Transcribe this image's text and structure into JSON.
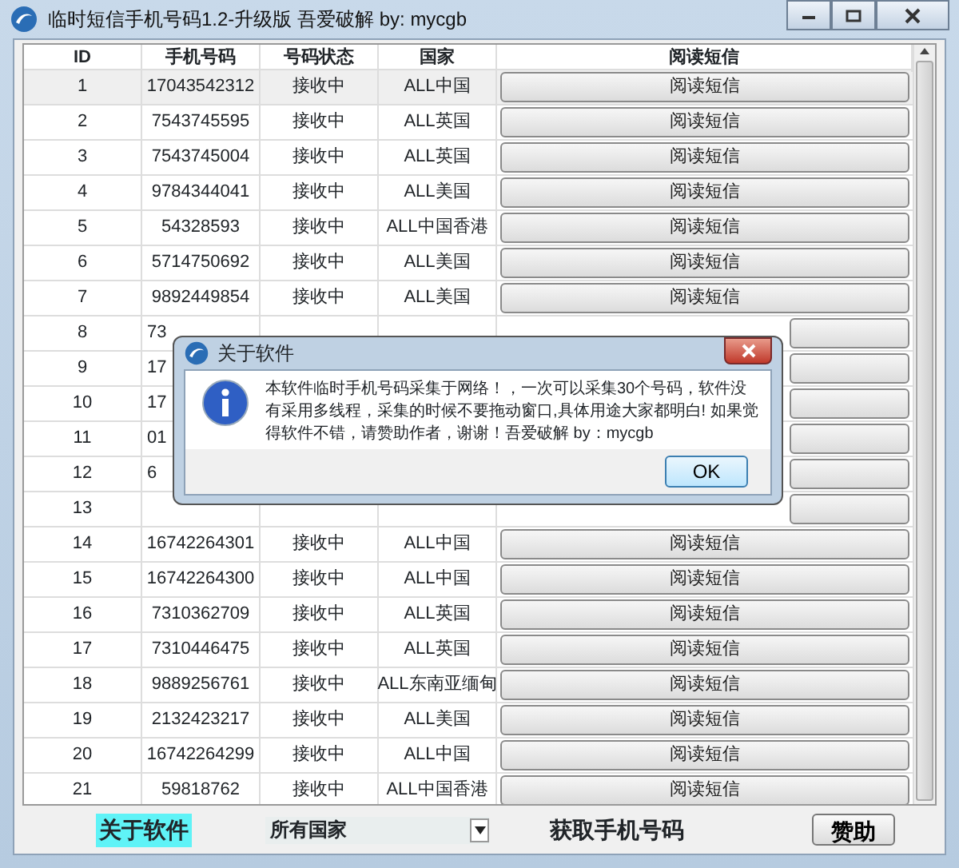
{
  "window": {
    "title": "临时短信手机号码1.2-升级版 吾爱破解 by: mycgb"
  },
  "table": {
    "columns": [
      "ID",
      "手机号码",
      "号码状态",
      "国家",
      "阅读短信"
    ],
    "rows": [
      {
        "kind": "full",
        "id": "1",
        "phone": "17043542312",
        "status": "接收中",
        "country": "ALL中国",
        "action": "阅读短信",
        "selected": true
      },
      {
        "kind": "full",
        "id": "2",
        "phone": "7543745595",
        "status": "接收中",
        "country": "ALL英国",
        "action": "阅读短信",
        "selected": false
      },
      {
        "kind": "full",
        "id": "3",
        "phone": "7543745004",
        "status": "接收中",
        "country": "ALL英国",
        "action": "阅读短信",
        "selected": false
      },
      {
        "kind": "full",
        "id": "4",
        "phone": "9784344041",
        "status": "接收中",
        "country": "ALL美国",
        "action": "阅读短信",
        "selected": false
      },
      {
        "kind": "full",
        "id": "5",
        "phone": "54328593",
        "status": "接收中",
        "country": "ALL中国香港",
        "action": "阅读短信",
        "selected": false
      },
      {
        "kind": "full",
        "id": "6",
        "phone": "5714750692",
        "status": "接收中",
        "country": "ALL美国",
        "action": "阅读短信",
        "selected": false
      },
      {
        "kind": "full",
        "id": "7",
        "phone": "9892449854",
        "status": "接收中",
        "country": "ALL美国",
        "action": "阅读短信",
        "selected": false
      },
      {
        "kind": "covered",
        "id": "8",
        "phone": "73",
        "selected": false
      },
      {
        "kind": "covered",
        "id": "9",
        "phone": "17",
        "selected": false
      },
      {
        "kind": "covered",
        "id": "10",
        "phone": "17",
        "selected": false
      },
      {
        "kind": "covered",
        "id": "11",
        "phone": "01",
        "selected": false
      },
      {
        "kind": "covered",
        "id": "12",
        "phone": "6",
        "selected": false
      },
      {
        "kind": "covered",
        "id": "13",
        "selected": false
      },
      {
        "kind": "full",
        "id": "14",
        "phone": "16742264301",
        "status": "接收中",
        "country": "ALL中国",
        "action": "阅读短信",
        "selected": false
      },
      {
        "kind": "full",
        "id": "15",
        "phone": "16742264300",
        "status": "接收中",
        "country": "ALL中国",
        "action": "阅读短信",
        "selected": false
      },
      {
        "kind": "full",
        "id": "16",
        "phone": "7310362709",
        "status": "接收中",
        "country": "ALL英国",
        "action": "阅读短信",
        "selected": false
      },
      {
        "kind": "full",
        "id": "17",
        "phone": "7310446475",
        "status": "接收中",
        "country": "ALL英国",
        "action": "阅读短信",
        "selected": false
      },
      {
        "kind": "full",
        "id": "18",
        "phone": "9889256761",
        "status": "接收中",
        "country": "ALL东南亚缅甸",
        "action": "阅读短信",
        "selected": false
      },
      {
        "kind": "full",
        "id": "19",
        "phone": "2132423217",
        "status": "接收中",
        "country": "ALL美国",
        "action": "阅读短信",
        "selected": false
      },
      {
        "kind": "full",
        "id": "20",
        "phone": "16742264299",
        "status": "接收中",
        "country": "ALL中国",
        "action": "阅读短信",
        "selected": false
      },
      {
        "kind": "full",
        "id": "21",
        "phone": "59818762",
        "status": "接收中",
        "country": "ALL中国香港",
        "action": "阅读短信",
        "selected": false
      }
    ]
  },
  "bottom_bar": {
    "about_label": "关于软件",
    "country_select": "所有国家",
    "fetch_label": "获取手机号码",
    "donate_button": "赞助"
  },
  "dialog": {
    "title": "关于软件",
    "message": "本软件临时手机号码采集于网络！，一次可以采集30个号码，软件没有采用多线程，采集的时候不要拖动窗口,具体用途大家都明白! 如果觉得软件不错，请赞助作者，谢谢！吾爱破解 by：mycgb",
    "ok_button": "OK"
  }
}
